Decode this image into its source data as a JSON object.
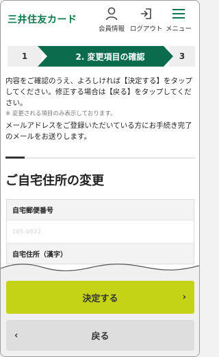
{
  "header": {
    "logo": "三井住友カード",
    "nav": [
      {
        "label": "会員情報",
        "icon": "person-icon"
      },
      {
        "label": "ログアウト",
        "icon": "logout-icon"
      },
      {
        "label": "メニュー",
        "icon": "hamburger-icon"
      }
    ]
  },
  "steps": {
    "step1": "1",
    "step2": "2. 変更項目の確認",
    "step3": "3",
    "current": 2,
    "colors": {
      "active": "#0b6b4d",
      "inactive": "#eeeeee"
    }
  },
  "intro": {
    "text1": "内容をご確認のうえ、よろしければ【決定する】をタップしてください。修正する場合は【戻る】をタップしてください。",
    "note": "※ 変更される項目のみ表示しております。",
    "text2": "メールアドレスをご登録いただいている方にお手続き完了のメールをお送りします。"
  },
  "section": {
    "title": "ご自宅住所の変更",
    "fields": [
      {
        "label": "自宅郵便番号",
        "value": "105-0022"
      },
      {
        "label": "自宅住所（漢字）",
        "value": ""
      }
    ]
  },
  "buttons": {
    "confirm": "決定する",
    "back": "戻る"
  },
  "colors": {
    "brand": "#0a7a4a",
    "confirm_button": "#c5d317",
    "back_button": "#dedede"
  }
}
